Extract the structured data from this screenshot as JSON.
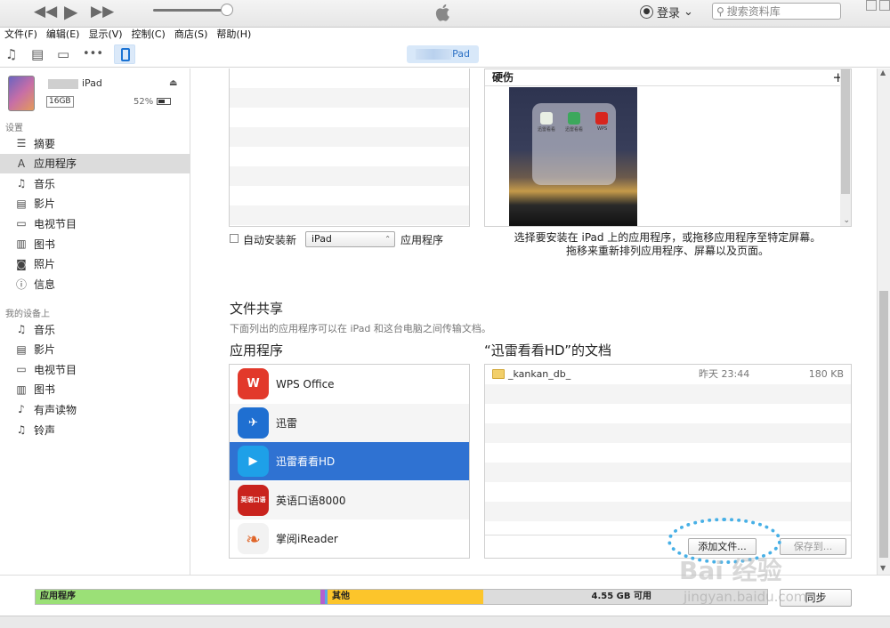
{
  "menu": [
    "文件(F)",
    "编辑(E)",
    "显示(V)",
    "控制(C)",
    "商店(S)",
    "帮助(H)"
  ],
  "topbar": {
    "login": "登录",
    "login_caret": "⌄",
    "search_placeholder": "搜索资料库"
  },
  "toolbar": {
    "device_pill_label": "iPad"
  },
  "device": {
    "name": "iPad",
    "capacity": "16GB",
    "battery": "52%"
  },
  "sidebar": {
    "settings_header": "设置",
    "settings_items": [
      {
        "label": "摘要",
        "icon": "summary-icon"
      },
      {
        "label": "应用程序",
        "icon": "apps-icon",
        "selected": true
      },
      {
        "label": "音乐",
        "icon": "music-icon"
      },
      {
        "label": "影片",
        "icon": "film-icon"
      },
      {
        "label": "电视节目",
        "icon": "tv-icon"
      },
      {
        "label": "图书",
        "icon": "book-icon"
      },
      {
        "label": "照片",
        "icon": "camera-icon"
      },
      {
        "label": "信息",
        "icon": "info-icon"
      }
    ],
    "ondevice_header": "我的设备上",
    "ondevice_items": [
      {
        "label": "音乐",
        "icon": "music-icon"
      },
      {
        "label": "影片",
        "icon": "film-icon"
      },
      {
        "label": "电视节目",
        "icon": "tv-icon"
      },
      {
        "label": "图书",
        "icon": "book-icon"
      },
      {
        "label": "有声读物",
        "icon": "audiobook-icon"
      },
      {
        "label": "铃声",
        "icon": "bell-icon"
      }
    ]
  },
  "home_screen": {
    "header": "硬伤",
    "plus": "+",
    "folder_apps": [
      "迅雷看看",
      "迅雷看看",
      "WPS"
    ]
  },
  "auto_install": {
    "label": "自动安装新",
    "device_option": "iPad",
    "suffix": "应用程序"
  },
  "instructions": {
    "line1": "选择要安装在 iPad 上的应用程序，或拖移应用程序至特定屏幕。",
    "line2": "拖移来重新排列应用程序、屏幕以及页面。"
  },
  "file_sharing": {
    "title": "文件共享",
    "subtitle": "下面列出的应用程序可以在 iPad 和这台电脑之间传输文档。",
    "apps_header": "应用程序",
    "docs_header": "“迅雷看看HD”的文档",
    "apps": [
      {
        "name": "WPS Office",
        "icon_text": "W",
        "color": "#e2392b"
      },
      {
        "name": "迅雷",
        "icon_text": "✈",
        "color": "#1f6fd1"
      },
      {
        "name": "迅雷看看HD",
        "icon_text": "▶",
        "color": "#1ea0e8",
        "selected": true
      },
      {
        "name": "英语口语8000",
        "icon_text": "英语口语",
        "color": "#c9231d"
      },
      {
        "name": "掌阅iReader",
        "icon_text": "❧",
        "color": "#f2f2f2"
      }
    ],
    "documents": [
      {
        "name": "_kankan_db_",
        "date": "昨天 23:44",
        "size": "180 KB"
      }
    ],
    "add_file_button": "添加文件...",
    "save_to_button": "保存到..."
  },
  "capacity_bar": {
    "apps_label": "应用程序",
    "other_label": "其他",
    "free_label": "4.55 GB 可用",
    "apps_color": "#9be077",
    "other_color": "#fcc52b",
    "free_color": "#dcdcdc",
    "sync_button": "同步"
  },
  "watermark": {
    "line1": "Bai 经验",
    "line2": "jingyan.baidu.com"
  }
}
